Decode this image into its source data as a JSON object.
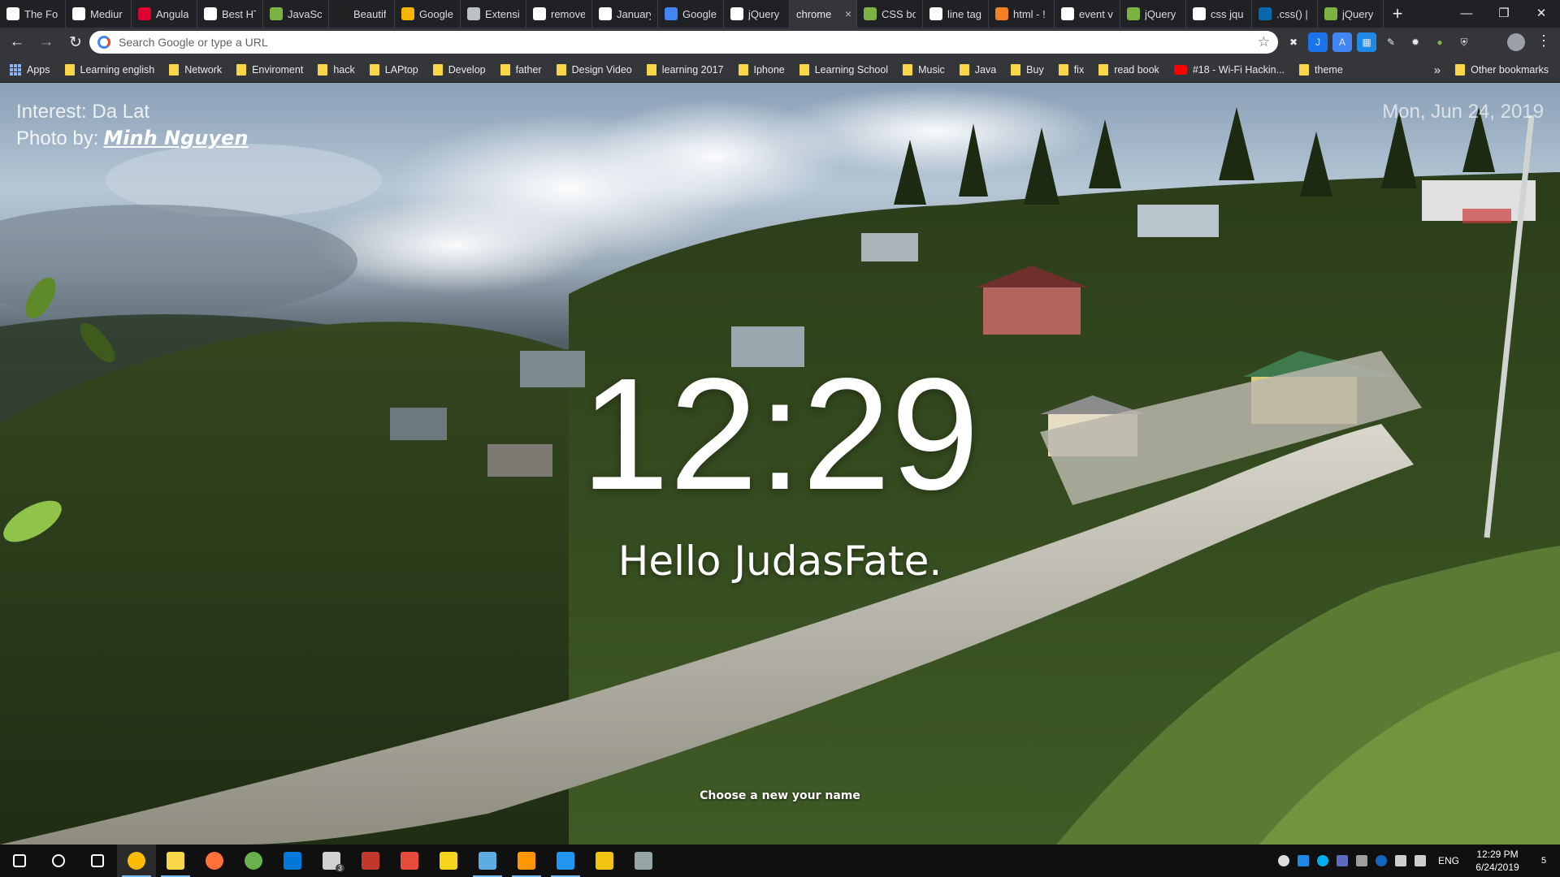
{
  "browser": {
    "tabs": [
      {
        "title": "The Fo",
        "icon": "document-icon",
        "color": "#ffffff"
      },
      {
        "title": "Mediur",
        "icon": "medium-icon",
        "color": "#ffffff"
      },
      {
        "title": "Angula",
        "icon": "angular-icon",
        "color": "#dd0031"
      },
      {
        "title": "Best HT",
        "icon": "medium-icon",
        "color": "#ffffff"
      },
      {
        "title": "JavaScri",
        "icon": "bookmark-icon",
        "color": "#7cb342"
      },
      {
        "title": "Beautif",
        "icon": "github-icon",
        "color": "#222222"
      },
      {
        "title": "Google",
        "icon": "extension-icon",
        "color": "#f4b400"
      },
      {
        "title": "Extensi",
        "icon": "puzzle-icon",
        "color": "#bdc1c6"
      },
      {
        "title": "remove",
        "icon": "google-icon",
        "color": "#ffffff"
      },
      {
        "title": "January",
        "icon": "wikipedia-icon",
        "color": "#ffffff"
      },
      {
        "title": "Google",
        "icon": "translate-icon",
        "color": "#4285f4"
      },
      {
        "title": "jQuery",
        "icon": "google-icon",
        "color": "#ffffff"
      },
      {
        "title": "chrome",
        "icon": "none",
        "color": "#35363a",
        "active": true
      },
      {
        "title": "CSS bo",
        "icon": "bookmark-icon",
        "color": "#7cb342"
      },
      {
        "title": "line tag",
        "icon": "google-icon",
        "color": "#ffffff"
      },
      {
        "title": "html - !",
        "icon": "stackoverflow-icon",
        "color": "#f48024"
      },
      {
        "title": "event v",
        "icon": "google-icon",
        "color": "#ffffff"
      },
      {
        "title": "jQuery",
        "icon": "bookmark-icon",
        "color": "#7cb342"
      },
      {
        "title": "css jqu",
        "icon": "google-icon",
        "color": "#ffffff"
      },
      {
        "title": ".css() | j",
        "icon": "jquery-icon",
        "color": "#0769ad"
      },
      {
        "title": "jQuery",
        "icon": "bookmark-icon",
        "color": "#7cb342"
      }
    ],
    "omnibox_placeholder": "Search Google or type a URL",
    "bookmarks": [
      {
        "label": "Apps",
        "type": "apps"
      },
      {
        "label": "Learning english",
        "type": "folder"
      },
      {
        "label": "Network",
        "type": "folder"
      },
      {
        "label": "Enviroment",
        "type": "folder"
      },
      {
        "label": "hack",
        "type": "folder"
      },
      {
        "label": "LAPtop",
        "type": "folder"
      },
      {
        "label": "Develop",
        "type": "folder"
      },
      {
        "label": "father",
        "type": "folder"
      },
      {
        "label": "Design Video",
        "type": "folder"
      },
      {
        "label": "learning 2017",
        "type": "folder"
      },
      {
        "label": "Iphone",
        "type": "folder"
      },
      {
        "label": "Learning School",
        "type": "folder"
      },
      {
        "label": "Music",
        "type": "folder"
      },
      {
        "label": "Java",
        "type": "folder"
      },
      {
        "label": "Buy",
        "type": "folder"
      },
      {
        "label": "fix",
        "type": "folder"
      },
      {
        "label": "read book",
        "type": "folder"
      },
      {
        "label": "#18 - Wi-Fi Hackin...",
        "type": "youtube"
      },
      {
        "label": "theme",
        "type": "folder"
      }
    ],
    "overflow_label": "»",
    "other_bookmarks": "Other bookmarks"
  },
  "newtab": {
    "interest": "Interest: Da Lat",
    "photo_by_label": "Photo by:",
    "photo_author": "Minh Nguyen",
    "date": "Mon, Jun 24, 2019",
    "clock": "12:29",
    "greeting": "Hello JudasFate.",
    "change_name": "Choose a new your name"
  },
  "taskbar": {
    "apps": [
      {
        "icon": "start-icon",
        "color": "#ffffff"
      },
      {
        "icon": "search-icon",
        "color": "#ffffff"
      },
      {
        "icon": "task-view-icon",
        "color": "#ffffff"
      },
      {
        "icon": "chrome-icon",
        "color": "#fbbc05",
        "running": true,
        "active": true
      },
      {
        "icon": "file-explorer-icon",
        "color": "#f9d548",
        "running": true
      },
      {
        "icon": "firefox-icon",
        "color": "#ff7139"
      },
      {
        "icon": "green-app-icon",
        "color": "#6ab04c"
      },
      {
        "icon": "store-icon",
        "color": "#0078d7"
      },
      {
        "icon": "mail-icon",
        "color": "#d0d0d0",
        "badge": "3"
      },
      {
        "icon": "red-game-icon",
        "color": "#c0392b"
      },
      {
        "icon": "red-app-icon",
        "color": "#e74c3c"
      },
      {
        "icon": "sticky-notes-icon",
        "color": "#f7d51d"
      },
      {
        "icon": "server-app-icon",
        "color": "#5dade2",
        "running": true
      },
      {
        "icon": "sublime-icon",
        "color": "#ff9800",
        "running": true
      },
      {
        "icon": "css3-editor-icon",
        "color": "#2196f3",
        "running": true
      },
      {
        "icon": "git-icon",
        "color": "#f1c40f"
      },
      {
        "icon": "paint-icon",
        "color": "#95a5a6"
      }
    ],
    "language": "ENG",
    "time": "12:29 PM",
    "date": "6/24/2019",
    "notification_count": "5"
  }
}
